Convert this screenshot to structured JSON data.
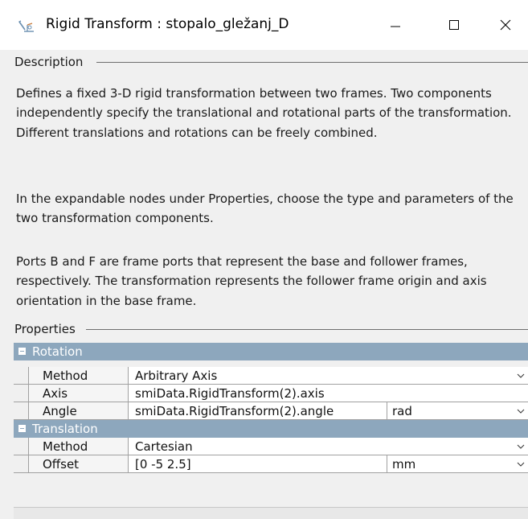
{
  "window": {
    "title": "Rigid Transform : stopalo_gležanj_D",
    "app_icon": "rigid-transform-block-icon",
    "controls": [
      "minimize-icon",
      "maximize-icon",
      "close-icon"
    ]
  },
  "description": {
    "label": "Description",
    "paragraphs": [
      "Defines a fixed 3-D rigid transformation between two frames. Two components independently specify the translational and rotational parts of the transformation. Different translations and rotations can be freely combined.",
      "In the expandable nodes under Properties, choose the type and parameters of the two transformation components.",
      "Ports B and F are frame ports that represent the base and follower frames, respectively. The transformation represents the follower frame origin and axis orientation in the base frame."
    ]
  },
  "properties": {
    "label": "Properties",
    "sections": [
      {
        "name": "Rotation",
        "rows": [
          {
            "name": "Method",
            "value": "Arbitrary Axis",
            "unit": null,
            "dropdown": true
          },
          {
            "name": "Axis",
            "value": "smiData.RigidTransform(2).axis",
            "unit": null,
            "dropdown": false
          },
          {
            "name": "Angle",
            "value": "smiData.RigidTransform(2).angle",
            "unit": "rad",
            "dropdown": true
          }
        ]
      },
      {
        "name": "Translation",
        "rows": [
          {
            "name": "Method",
            "value": "Cartesian",
            "unit": null,
            "dropdown": true
          },
          {
            "name": "Offset",
            "value": "[0 -5 2.5]",
            "unit": "mm",
            "dropdown": true
          }
        ]
      }
    ]
  },
  "colors": {
    "section_header": "#8da7bd",
    "background": "#f0f0f0"
  }
}
